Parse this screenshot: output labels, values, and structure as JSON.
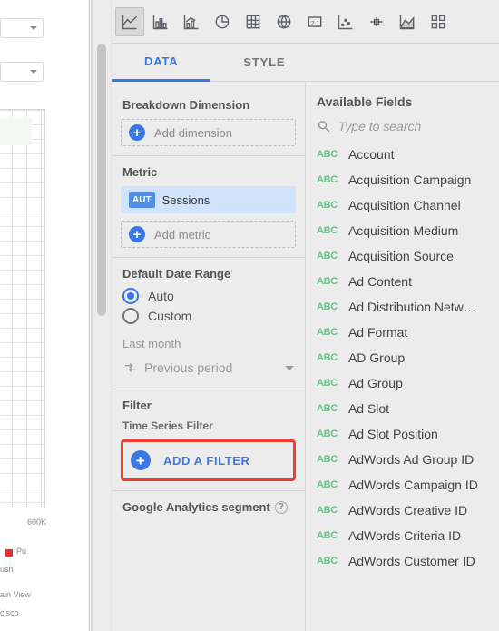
{
  "tabs": {
    "data": "DATA",
    "style": "STYLE",
    "active": "data"
  },
  "sections": {
    "breakdown": {
      "title": "Breakdown Dimension",
      "add": "Add dimension"
    },
    "metric": {
      "title": "Metric",
      "type_badge": "AUT",
      "value": "Sessions",
      "add": "Add metric"
    },
    "date": {
      "title": "Default Date Range",
      "auto": "Auto",
      "custom": "Custom",
      "last": "Last month",
      "compare": "Previous period"
    },
    "filter": {
      "title": "Filter",
      "sub": "Time Series Filter",
      "button": "ADD A FILTER"
    },
    "segment": {
      "title": "Google Analytics segment"
    }
  },
  "fields_panel": {
    "title": "Available Fields",
    "search_placeholder": "Type to search",
    "type_label": "ABC",
    "items": [
      "Account",
      "Acquisition Campaign",
      "Acquisition Channel",
      "Acquisition Medium",
      "Acquisition Source",
      "Ad Content",
      "Ad Distribution Netw…",
      "Ad Format",
      "AD Group",
      "Ad Group",
      "Ad Slot",
      "Ad Slot Position",
      "AdWords Ad Group ID",
      "AdWords Campaign ID",
      "AdWords Creative ID",
      "AdWords Criteria ID",
      "AdWords Customer ID"
    ]
  },
  "canvas": {
    "label_600k": "600K",
    "legend1": "Pu",
    "legend2": "ush",
    "legend3": "ain View",
    "legend4": "cisco"
  }
}
